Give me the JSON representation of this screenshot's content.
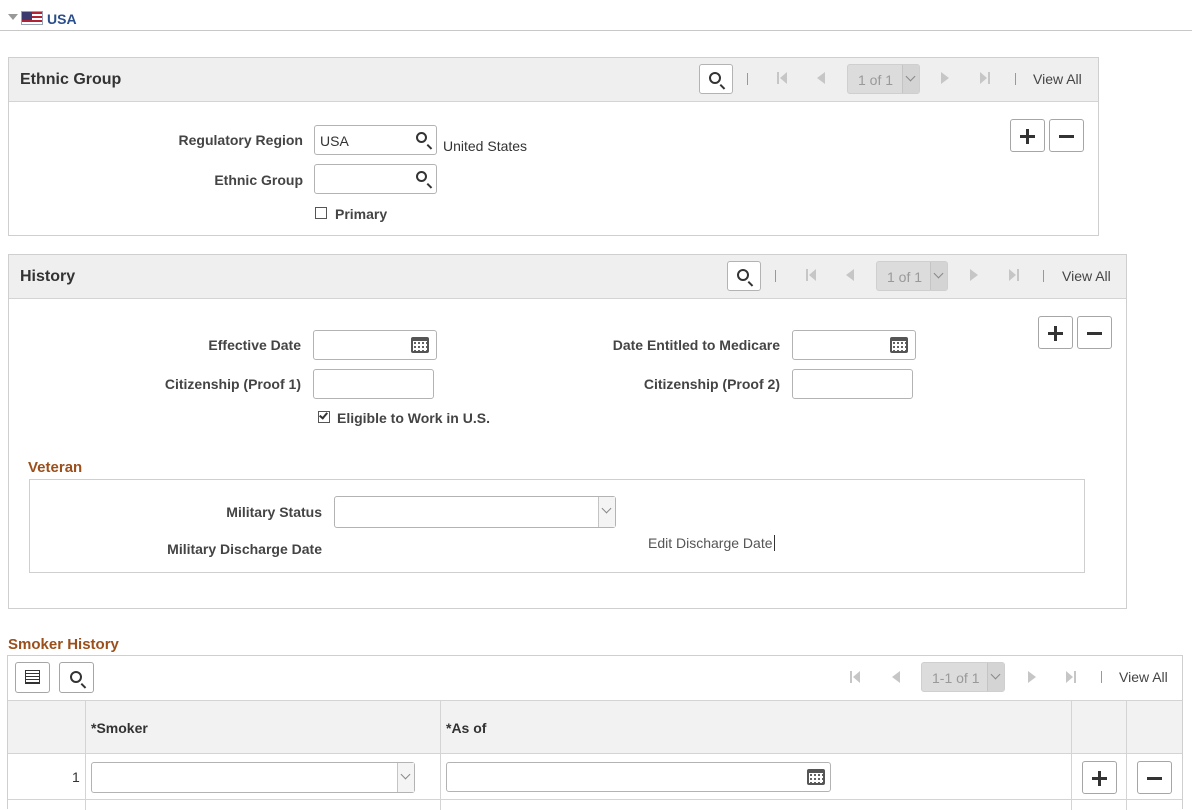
{
  "country": {
    "name": "USA"
  },
  "ethnic_group": {
    "title": "Ethnic Group",
    "nav": {
      "counter": "1 of 1",
      "view_all": "View All"
    },
    "regulatory_region": {
      "label": "Regulatory Region",
      "value": "USA",
      "description": "United States"
    },
    "ethnic_group_field": {
      "label": "Ethnic Group",
      "value": ""
    },
    "primary": {
      "label": "Primary",
      "checked": false
    }
  },
  "history": {
    "title": "History",
    "nav": {
      "counter": "1 of 1",
      "view_all": "View All"
    },
    "effective_date": {
      "label": "Effective Date",
      "value": ""
    },
    "medicare_date": {
      "label": "Date Entitled to Medicare",
      "value": ""
    },
    "citizenship1": {
      "label": "Citizenship (Proof 1)",
      "value": ""
    },
    "citizenship2": {
      "label": "Citizenship (Proof 2)",
      "value": ""
    },
    "eligible_work": {
      "label": "Eligible to Work in U.S.",
      "checked": true
    },
    "veteran": {
      "title": "Veteran",
      "military_status": {
        "label": "Military Status",
        "value": ""
      },
      "discharge_date": {
        "label": "Military Discharge Date"
      },
      "edit_discharge": "Edit Discharge Date"
    }
  },
  "smoker_history": {
    "title": "Smoker History",
    "nav": {
      "counter": "1-1 of 1",
      "view_all": "View All"
    },
    "columns": [
      "*Smoker",
      "*As of"
    ],
    "rows": [
      {
        "num": "1",
        "smoker": "",
        "as_of": ""
      }
    ]
  },
  "icons": [
    "collapse-arrow-icon",
    "us-flag-icon",
    "search-icon",
    "first-page-icon",
    "previous-page-icon",
    "next-page-icon",
    "last-page-icon",
    "calendar-icon",
    "add-row-icon",
    "delete-row-icon",
    "grid-personalize-icon"
  ]
}
